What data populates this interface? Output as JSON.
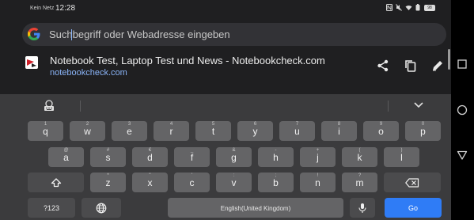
{
  "status_bar": {
    "carrier": "Kein Netz",
    "time": "12:28",
    "battery": "98",
    "icons": [
      "nfc-icon",
      "mute-icon",
      "wifi-icon",
      "battery-saver-icon",
      "battery-icon"
    ]
  },
  "search": {
    "placeholder": "Suchbegriff oder Webadresse eingeben",
    "value": ""
  },
  "suggestion": {
    "title": "Notebook Test, Laptop Test und News - Notebookcheck.com",
    "url": "notebookcheck.com",
    "actions": [
      "share-icon",
      "copy-icon",
      "edit-icon"
    ]
  },
  "keyboard": {
    "row1": [
      {
        "label": "q",
        "hint": "1"
      },
      {
        "label": "w",
        "hint": "2"
      },
      {
        "label": "e",
        "hint": "3"
      },
      {
        "label": "r",
        "hint": "4"
      },
      {
        "label": "t",
        "hint": "5"
      },
      {
        "label": "y",
        "hint": "6"
      },
      {
        "label": "u",
        "hint": "7"
      },
      {
        "label": "i",
        "hint": "8"
      },
      {
        "label": "o",
        "hint": "9"
      },
      {
        "label": "p",
        "hint": "0"
      }
    ],
    "row2": [
      {
        "label": "a",
        "hint": "@"
      },
      {
        "label": "s",
        "hint": "#"
      },
      {
        "label": "d",
        "hint": "€"
      },
      {
        "label": "f",
        "hint": "_"
      },
      {
        "label": "g",
        "hint": "&"
      },
      {
        "label": "h",
        "hint": "-"
      },
      {
        "label": "j",
        "hint": "+"
      },
      {
        "label": "k",
        "hint": "("
      },
      {
        "label": "l",
        "hint": ")"
      }
    ],
    "row3": [
      {
        "label": "z",
        "hint": "*"
      },
      {
        "label": "x",
        "hint": "\""
      },
      {
        "label": "c",
        "hint": "'"
      },
      {
        "label": "v",
        "hint": ":"
      },
      {
        "label": "b",
        "hint": ";"
      },
      {
        "label": "n",
        "hint": "!"
      },
      {
        "label": "m",
        "hint": "?"
      }
    ],
    "symbols_label": "?123",
    "space_label": "English(United Kingdom)",
    "go_label": "Go"
  }
}
